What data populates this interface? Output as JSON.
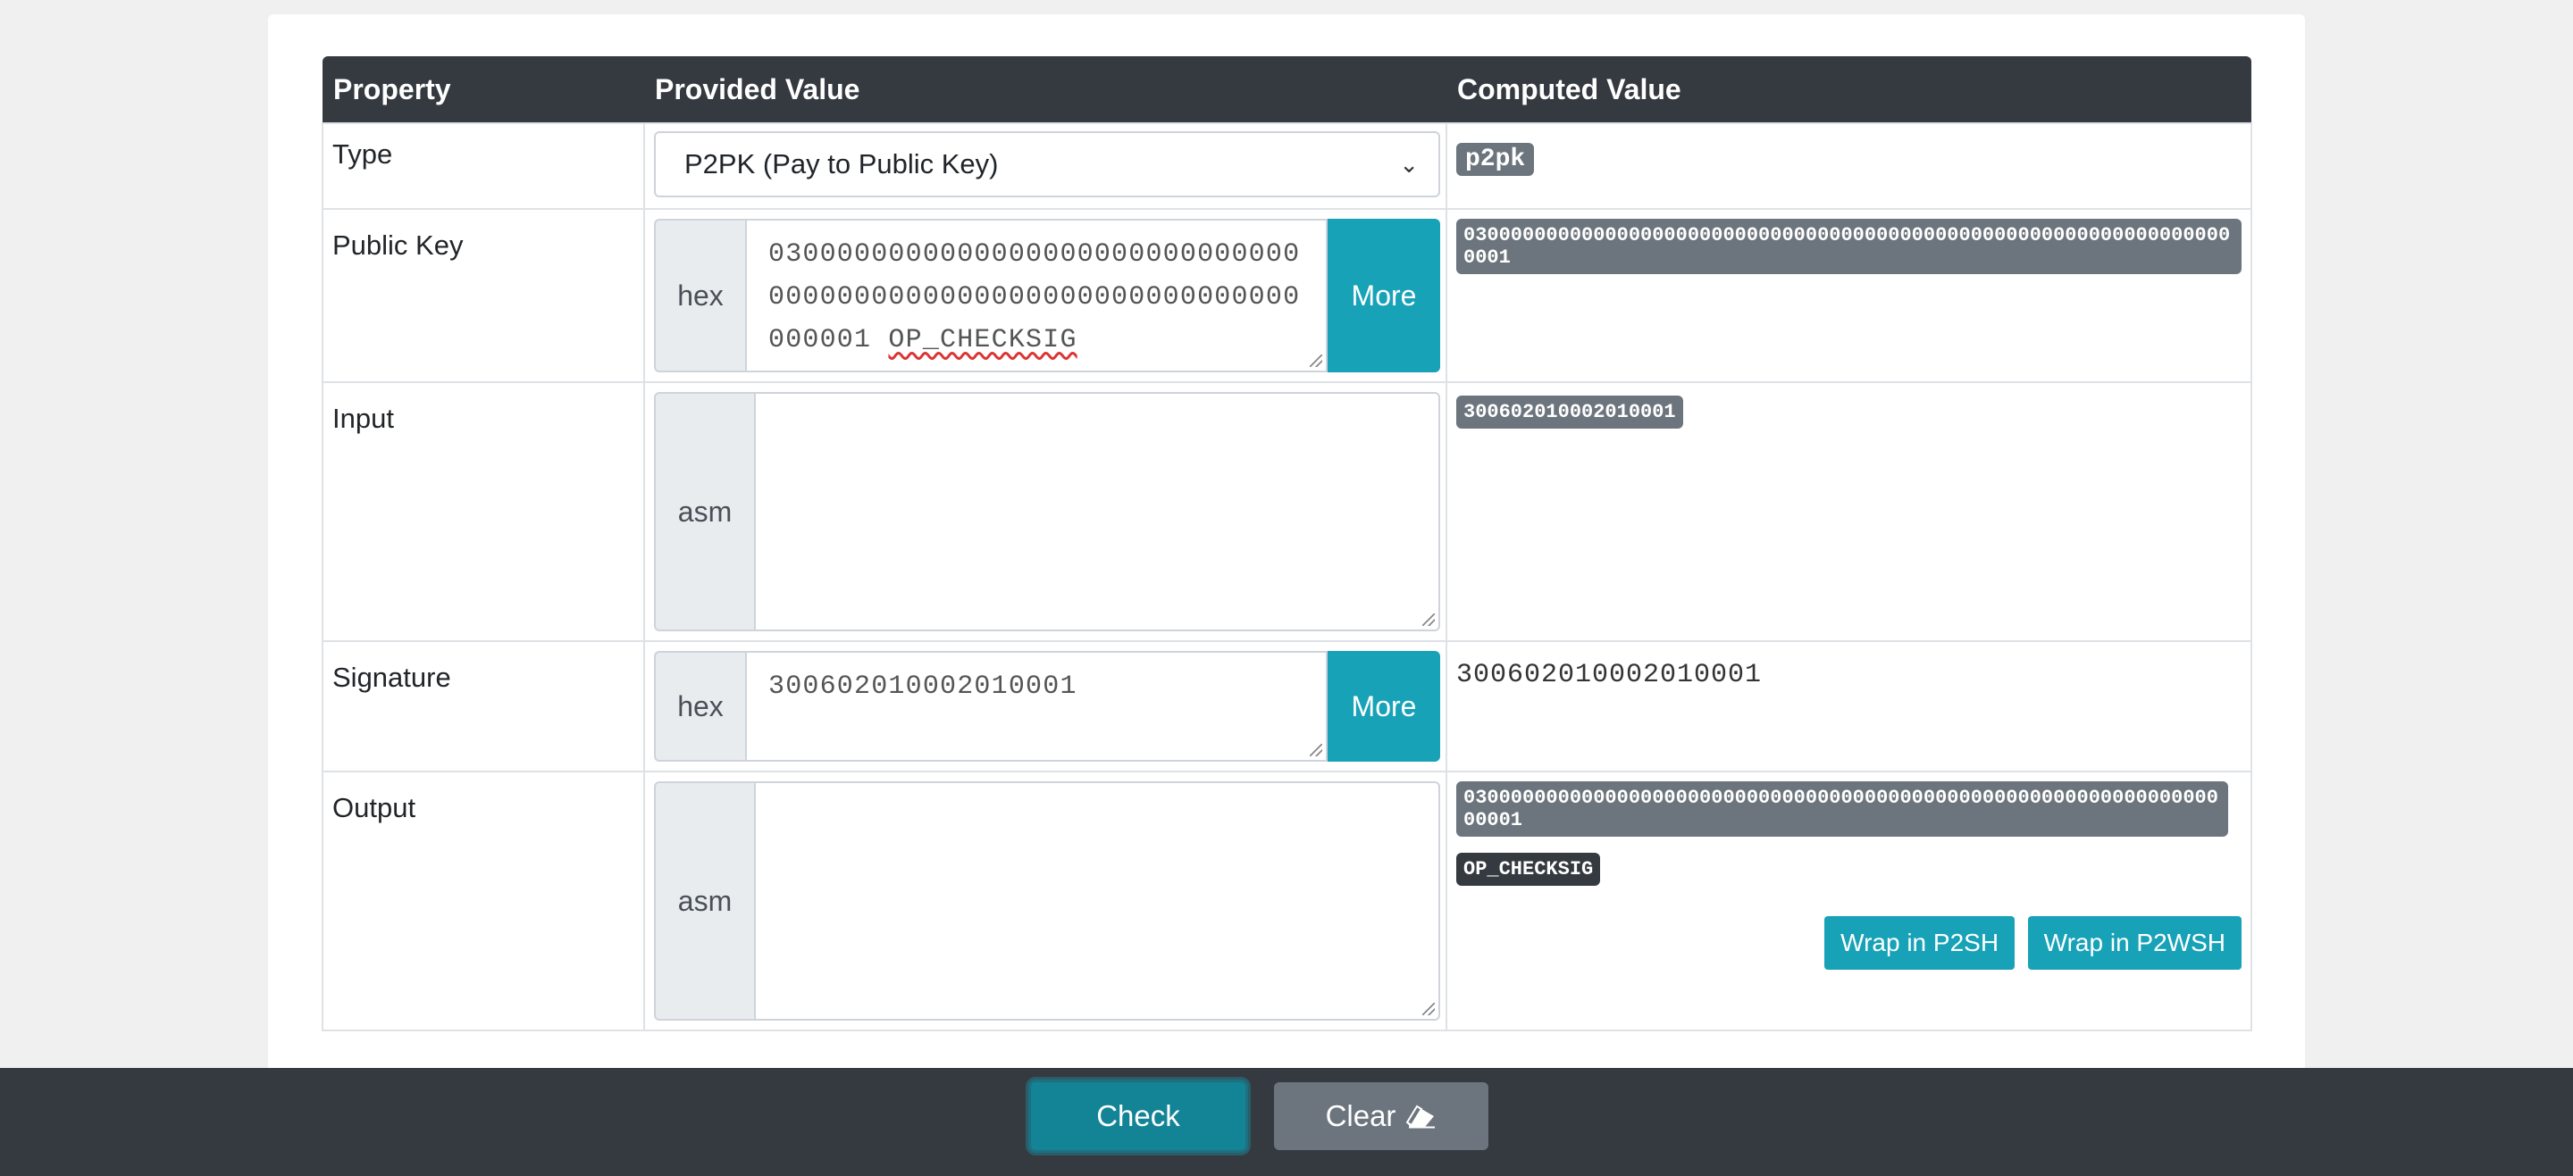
{
  "table": {
    "headers": {
      "property": "Property",
      "provided": "Provided Value",
      "computed": "Computed Value"
    },
    "rows": {
      "type": {
        "label": "Type",
        "select_value": "P2PK (Pay to Public Key)",
        "computed_badge": "p2pk"
      },
      "public_key": {
        "label": "Public Key",
        "addon": "hex",
        "value_hex": "03000000000000000000000000000000000000000000000000000000000000000001",
        "value_op": "OP_CHECKSIG",
        "more": "More",
        "computed_badge": "030000000000000000000000000000000000000000000000000000000000000000001"
      },
      "input": {
        "label": "Input",
        "addon": "asm",
        "value": "",
        "computed_badge": "300602010002010001"
      },
      "signature": {
        "label": "Signature",
        "addon": "hex",
        "value": "300602010002010001",
        "more": "More",
        "computed_text": "300602010002010001"
      },
      "output": {
        "label": "Output",
        "addon": "asm",
        "value": "",
        "computed_badge": "030000000000000000000000000000000000000000000000000000000000000000001",
        "computed_op_badge": "OP_CHECKSIG",
        "wrap_p2sh": "Wrap in P2SH",
        "wrap_p2wsh": "Wrap in P2WSH"
      }
    }
  },
  "footer": {
    "check": "Check",
    "clear": "Clear",
    "clear_icon": "eraser-icon"
  },
  "colors": {
    "header_bg": "#343a40",
    "accent": "#17a2b8",
    "badge_gray": "#6c757d",
    "badge_dark": "#343a40"
  }
}
